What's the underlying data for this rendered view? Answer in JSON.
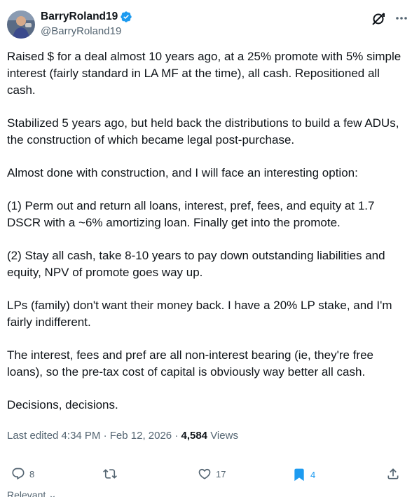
{
  "author": {
    "display_name": "BarryRoland19",
    "handle": "@BarryRoland19",
    "verified": true,
    "avatar_icon": "user-avatar"
  },
  "tweet": {
    "paragraphs": [
      "Raised $ for a deal almost 10 years ago, at a 25% promote with 5% simple interest (fairly standard in LA MF at the time), all cash. Repositioned all cash.",
      "Stabilized 5 years ago, but held back the distributions to build a few ADUs, the construction of which became legal post-purchase.",
      "Almost done with construction, and I will face an interesting option:",
      "(1) Perm out and return all loans, interest, pref, fees, and equity at 1.7 DSCR with a ~6% amortizing loan. Finally get into the promote.",
      "(2) Stay all cash, take 8-10 years to pay down outstanding liabilities and equity, NPV of promote goes way up.",
      "LPs (family) don't want their money back. I have a 20% LP stake, and I'm fairly indifferent.",
      "The interest, fees and pref are all non-interest bearing (ie, they're free loans), so the pre-tax cost of capital is obviously way better all cash.",
      "Decisions, decisions."
    ]
  },
  "meta": {
    "edited": "Last edited 4:34 PM · Feb 12, 2026 · ",
    "views_count": "4,584",
    "views_label": " Views"
  },
  "actions": {
    "reply_count": "8",
    "repost_count": "",
    "like_count": "17",
    "bookmark_count": "4"
  },
  "replies_sort": "Relevant",
  "colors": {
    "accent": "#1d9bf0",
    "secondary_text": "#536471",
    "primary_text": "#0f1419"
  }
}
